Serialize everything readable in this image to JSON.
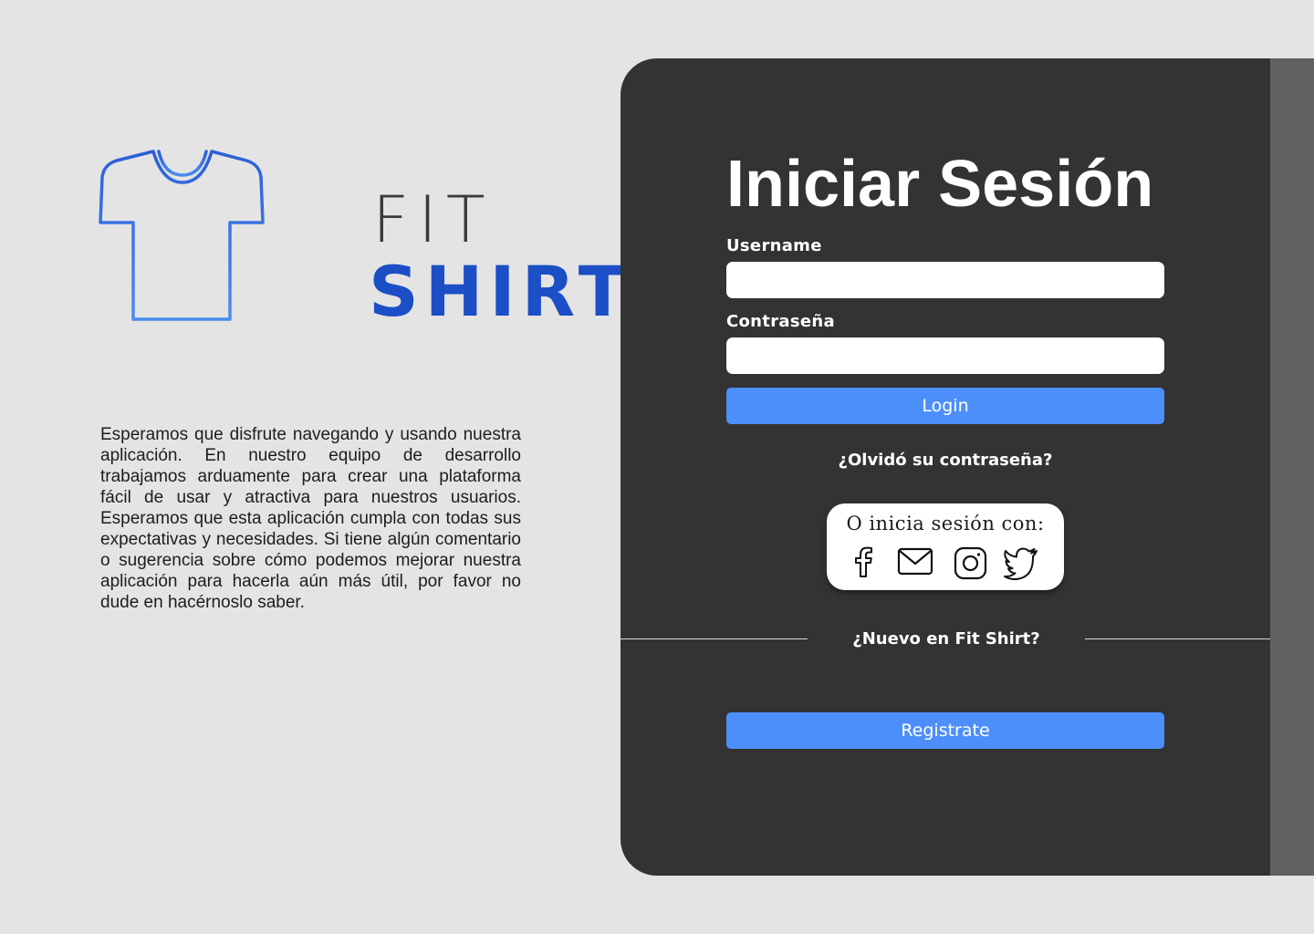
{
  "brand": {
    "line1": "FIT",
    "line2": "SHIRT",
    "logo_icon": "t-shirt-icon",
    "colors": {
      "fit": "#3b3b3b",
      "shirt": "#1c4fc6",
      "icon_gradient_top": "#2c5fd6",
      "icon_gradient_bottom": "#4b8dee"
    }
  },
  "intro_text": "Esperamos que disfrute navegando y usando nuestra aplicación. En nuestro equipo de desarrollo trabajamos arduamente para crear una plataforma fácil de usar y atractiva para nuestros usuarios. Esperamos que esta aplicación cumpla con todas sus expectativas y necesidades. Si tiene algún comentario o sugerencia sobre cómo podemos mejorar nuestra aplicación para hacerla aún más útil, por favor no dude en hacérnoslo saber.",
  "login": {
    "title": "Iniciar Sesión",
    "username_label": "Username",
    "username_value": "",
    "password_label": "Contraseña",
    "password_value": "",
    "login_button": "Login",
    "forgot_link": "¿Olvidó su contraseña?"
  },
  "social": {
    "caption": "O inicia sesión con:",
    "icons": [
      "facebook-icon",
      "mail-icon",
      "instagram-icon",
      "twitter-icon"
    ]
  },
  "register": {
    "prompt": "¿Nuevo en Fit Shirt?",
    "button": "Registrate"
  },
  "colors": {
    "page_background": "#e4e4e4",
    "panel_background": "#333333",
    "scrollbar": "#616161",
    "accent_button": "#4d8ffa",
    "text_light": "#ffffff"
  }
}
